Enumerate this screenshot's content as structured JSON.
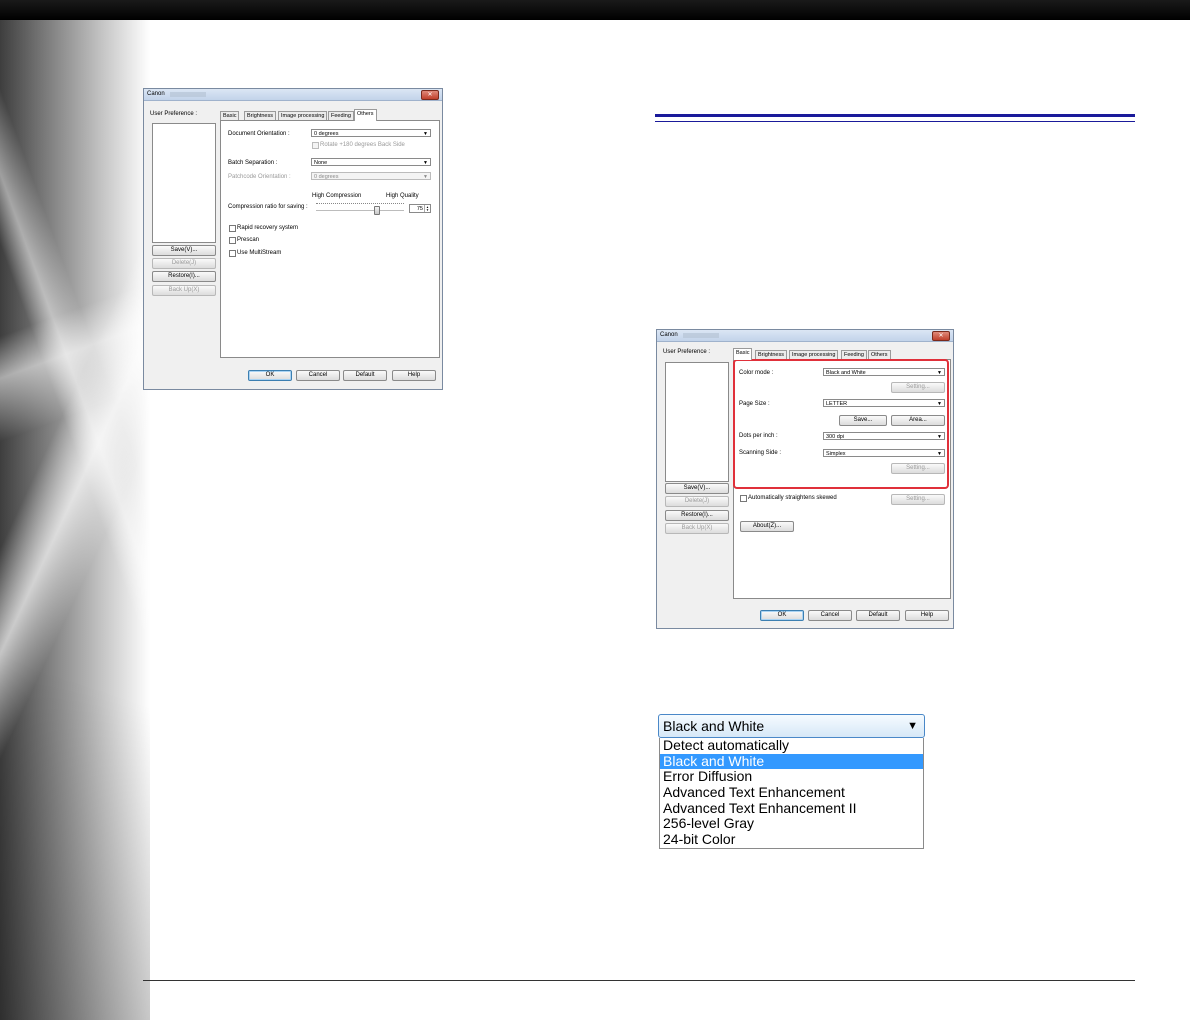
{
  "dialog_others": {
    "title": "Canon",
    "close": "✕",
    "user_preference_label": "User Preference :",
    "buttons": {
      "save": "Save(V)...",
      "delete": "Delete(J)",
      "restore": "Restore(I)...",
      "backup": "Back Up(X)"
    },
    "tabs": [
      "Basic",
      "Brightness",
      "Image processing",
      "Feeding",
      "Others"
    ],
    "active_tab": "Others",
    "document_orientation_label": "Document Orientation :",
    "document_orientation_value": "0 degrees",
    "rotate_back_side": "Rotate +180 degrees Back Side",
    "batch_separation_label": "Batch Separation :",
    "batch_separation_value": "None",
    "patchcode_orientation_label": "Patchcode Orientation :",
    "patchcode_orientation_value": "0 degrees",
    "high_compression": "High Compression",
    "high_quality": "High Quality",
    "compression_label": "Compression ratio for saving :",
    "compression_value": "75",
    "rapid_recovery": "Rapid recovery system",
    "prescan": "Prescan",
    "multistream": "Use MultiStream",
    "ok": "OK",
    "cancel": "Cancel",
    "default": "Default",
    "help": "Help"
  },
  "dialog_basic": {
    "title": "Canon",
    "close": "✕",
    "user_preference_label": "User Preference :",
    "buttons": {
      "save": "Save(V)...",
      "delete": "Delete(J)",
      "restore": "Restore(I)...",
      "backup": "Back Up(X)"
    },
    "tabs": [
      "Basic",
      "Brightness",
      "Image processing",
      "Feeding",
      "Others"
    ],
    "active_tab": "Basic",
    "color_mode_label": "Color mode :",
    "color_mode_value": "Black and White",
    "setting": "Setting...",
    "page_size_label": "Page Size :",
    "page_size_value": "LETTER",
    "save_btn": "Save...",
    "area_btn": "Area...",
    "dpi_label": "Dots per inch :",
    "dpi_value": "300 dpi",
    "scanning_side_label": "Scanning Side :",
    "scanning_side_value": "Simplex",
    "auto_straighten": "Automatically straightens skewed",
    "about": "About(Z)...",
    "ok": "OK",
    "cancel": "Cancel",
    "default": "Default",
    "help": "Help"
  },
  "color_dropdown": {
    "selected": "Black and White",
    "options": [
      "Detect automatically",
      "Black and White",
      "Error Diffusion",
      "Advanced Text Enhancement",
      "Advanced Text Enhancement II",
      "256-level Gray",
      "24-bit Color"
    ],
    "highlighted_index": 1
  },
  "colors": {
    "rule_blue": "#1a1a9a",
    "highlight_red": "#e0303a",
    "selection_blue": "#3399ff"
  }
}
